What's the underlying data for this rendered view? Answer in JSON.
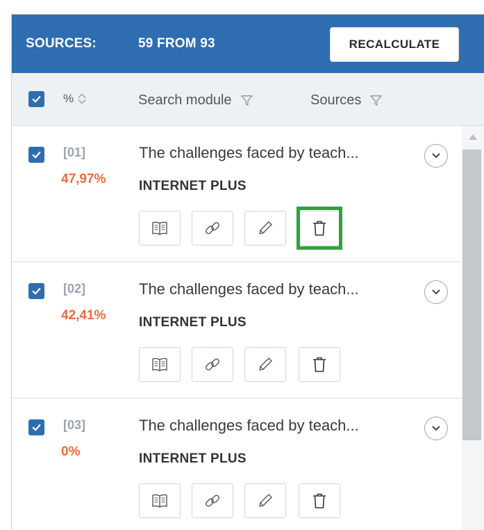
{
  "header": {
    "title": "SOURCES:",
    "count": "59 FROM 93",
    "recalculate_label": "RECALCULATE",
    "bg_color": "#2f6db1"
  },
  "columns": {
    "percent_label": "%",
    "search_module_label": "Search module",
    "sources_label": "Sources"
  },
  "rows": [
    {
      "index": "[01]",
      "percent": "47,97%",
      "title": "The challenges faced by teach...",
      "module": "INTERNET PLUS",
      "checked": true
    },
    {
      "index": "[02]",
      "percent": "42,41%",
      "title": "The challenges faced by teach...",
      "module": "INTERNET PLUS",
      "checked": true
    },
    {
      "index": "[03]",
      "percent": "0%",
      "title": "The challenges faced by teach...",
      "module": "INTERNET PLUS",
      "checked": true
    }
  ],
  "icons": {
    "expand": "chevron-down-icon",
    "book": "book-icon",
    "link": "link-icon",
    "edit": "pencil-icon",
    "delete": "trash-icon",
    "filter": "filter-icon",
    "sort": "sort-icon"
  },
  "colors": {
    "accent": "#2f6db1",
    "percent": "#f06a3e",
    "highlight": "#2ea33c"
  }
}
